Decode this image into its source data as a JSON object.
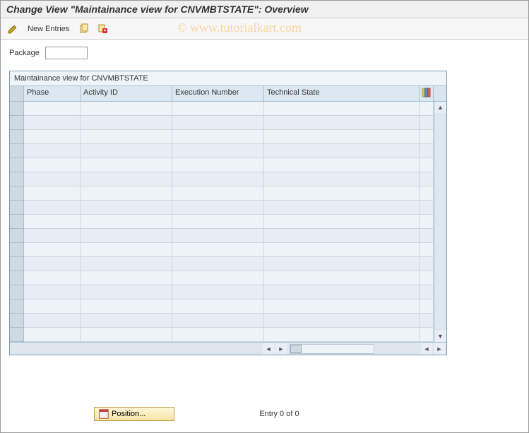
{
  "title": "Change View \"Maintainance view for CNVMBTSTATE\": Overview",
  "toolbar": {
    "new_entries_label": "New Entries"
  },
  "watermark": "© www.tutorialkart.com",
  "form": {
    "package_label": "Package",
    "package_value": ""
  },
  "grid": {
    "panel_title": "Maintainance view for CNVMBTSTATE",
    "columns": {
      "phase": "Phase",
      "activity_id": "Activity ID",
      "execution_number": "Execution  Number",
      "technical_state": "Technical State"
    },
    "row_count": 17
  },
  "footer": {
    "position_label": "Position...",
    "entry_text": "Entry 0 of 0"
  }
}
